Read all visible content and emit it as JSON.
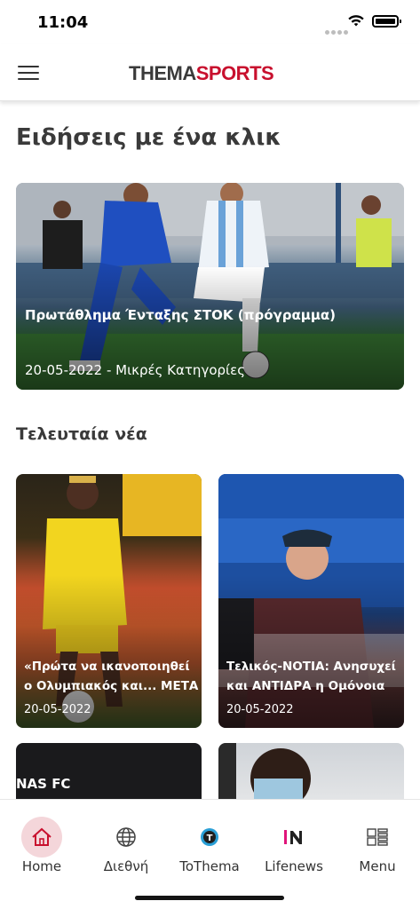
{
  "status_bar": {
    "time": "11:04"
  },
  "header": {
    "logo_part1": "THEMA",
    "logo_part2": "SPORTS",
    "brand_color": "#c8102e"
  },
  "sections": {
    "featured_title": "Ειδήσεις με ένα κλικ",
    "latest_title": "Τελευταία νέα"
  },
  "featured": {
    "title": "Πρωτάθλημα Ένταξης ΣΤΟΚ (πρόγραμμα)",
    "meta": "20-05-2022 - Μικρές Κατηγορίες"
  },
  "latest": [
    {
      "title": "«Πρώτα να ικανοποιηθεί ο Ολυμπιακός και... ΜΕΤΑ",
      "date": "20-05-2022"
    },
    {
      "title": "Τελικός-ΝΟΤΙΑ: Ανησυχεί και ΑΝΤΙΔΡΑ η Ομόνοια",
      "date": "20-05-2022"
    },
    {
      "title": "",
      "date": "",
      "overlay_text": "NAS FC"
    },
    {
      "title": "",
      "date": ""
    }
  ],
  "tabs": [
    {
      "label": "Home",
      "icon": "home-icon",
      "active": true
    },
    {
      "label": "Διεθνή",
      "icon": "globe-icon",
      "active": false
    },
    {
      "label": "ToThema",
      "icon": "tothema-icon",
      "active": false
    },
    {
      "label": "Lifenews",
      "icon": "lifenews-icon",
      "active": false
    },
    {
      "label": "Menu",
      "icon": "menu-grid-icon",
      "active": false
    }
  ],
  "colors": {
    "active_tab_bg": "#f4d6da",
    "home_icon": "#c8102e"
  }
}
